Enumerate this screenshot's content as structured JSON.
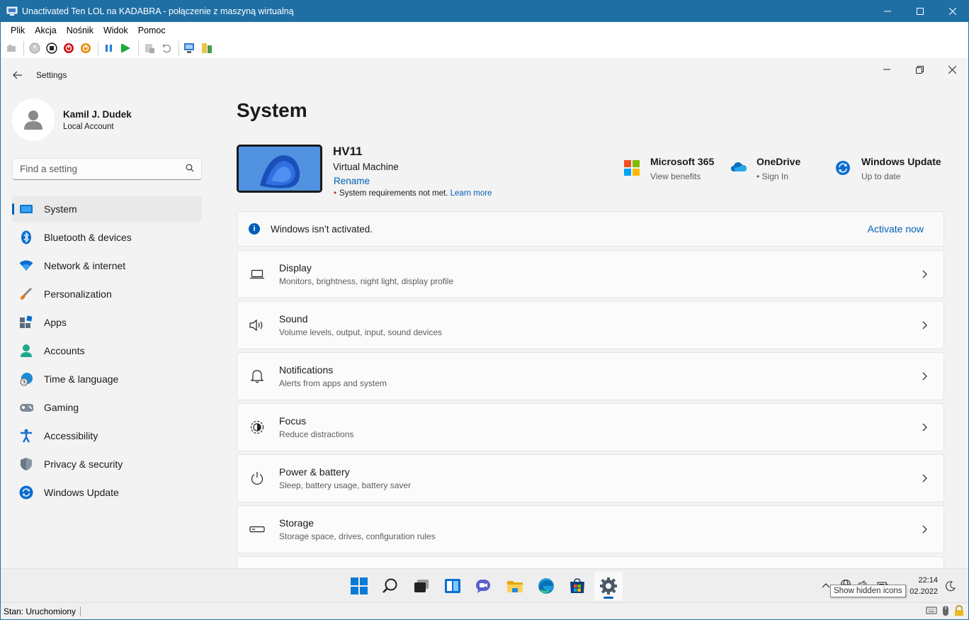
{
  "vm_window": {
    "title": "Unactivated Ten LOL na KADABRA - połączenie z maszyną wirtualną",
    "menu": [
      "Plik",
      "Akcja",
      "Nośnik",
      "Widok",
      "Pomoc"
    ]
  },
  "settings": {
    "app_label": "Settings",
    "profile": {
      "name": "Kamil J. Dudek",
      "account_type": "Local Account"
    },
    "search": {
      "placeholder": "Find a setting"
    },
    "nav": [
      {
        "label": "System",
        "icon": "system-icon",
        "active": true
      },
      {
        "label": "Bluetooth & devices",
        "icon": "bluetooth-icon"
      },
      {
        "label": "Network & internet",
        "icon": "wifi-icon"
      },
      {
        "label": "Personalization",
        "icon": "brush-icon"
      },
      {
        "label": "Apps",
        "icon": "apps-icon"
      },
      {
        "label": "Accounts",
        "icon": "person-icon"
      },
      {
        "label": "Time & language",
        "icon": "globe-clock-icon"
      },
      {
        "label": "Gaming",
        "icon": "gamepad-icon"
      },
      {
        "label": "Accessibility",
        "icon": "accessibility-icon"
      },
      {
        "label": "Privacy & security",
        "icon": "shield-icon"
      },
      {
        "label": "Windows Update",
        "icon": "update-icon"
      }
    ],
    "page_title": "System",
    "device": {
      "name": "HV11",
      "type": "Virtual Machine",
      "rename": "Rename",
      "requirements_note": "System requirements not met.",
      "learn_more": "Learn more"
    },
    "quick_links": [
      {
        "title": "Microsoft 365",
        "subtitle": "View benefits",
        "icon": "microsoft365-icon"
      },
      {
        "title": "OneDrive",
        "subtitle": "• Sign In",
        "icon": "onedrive-icon"
      },
      {
        "title": "Windows Update",
        "subtitle": "Up to date",
        "icon": "windows-update-icon"
      }
    ],
    "activation": {
      "message": "Windows isn’t activated.",
      "action": "Activate now"
    },
    "cards": [
      {
        "title": "Display",
        "subtitle": "Monitors, brightness, night light, display profile",
        "icon": "display-icon"
      },
      {
        "title": "Sound",
        "subtitle": "Volume levels, output, input, sound devices",
        "icon": "speaker-icon"
      },
      {
        "title": "Notifications",
        "subtitle": "Alerts from apps and system",
        "icon": "bell-icon"
      },
      {
        "title": "Focus",
        "subtitle": "Reduce distractions",
        "icon": "focus-icon"
      },
      {
        "title": "Power & battery",
        "subtitle": "Sleep, battery usage, battery saver",
        "icon": "power-icon"
      },
      {
        "title": "Storage",
        "subtitle": "Storage space, drives, configuration rules",
        "icon": "storage-icon"
      }
    ]
  },
  "taskbar": {
    "clock_time": "22:14",
    "clock_date": "02.2022",
    "tooltip": "Show hidden icons"
  },
  "statusbar": {
    "text": "Stan: Uruchomiony"
  },
  "colors": {
    "accent": "#005fb8",
    "vm_titlebar": "#1f6fa5"
  }
}
